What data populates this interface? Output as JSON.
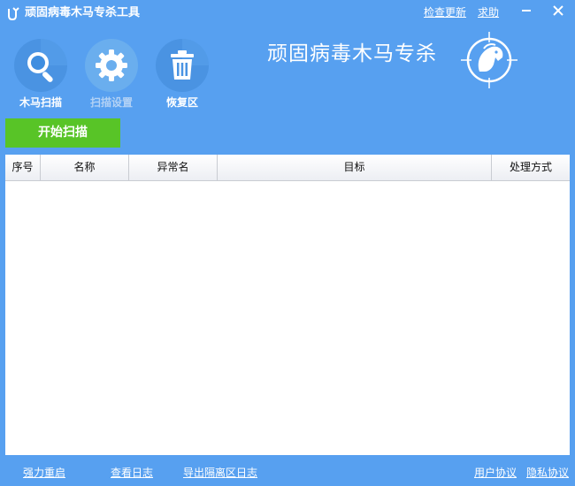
{
  "window": {
    "title": "顽固病毒木马专杀工具",
    "links": {
      "check_update": "检查更新",
      "help": "求助"
    },
    "controls": {
      "minimize": "minimize-icon",
      "close": "close-icon"
    }
  },
  "toolbar": {
    "items": [
      {
        "label": "木马扫描",
        "icon": "magnifier-icon",
        "state": "active"
      },
      {
        "label": "扫描设置",
        "icon": "gear-icon",
        "state": "dimmed"
      },
      {
        "label": "恢复区",
        "icon": "trash-icon",
        "state": "active"
      }
    ]
  },
  "brand": {
    "text": "顽固病毒木马专杀",
    "logo_icon": "trojan-horse-crosshair-icon"
  },
  "actions": {
    "start_scan": "开始扫描"
  },
  "table": {
    "columns": [
      "序号",
      "名称",
      "异常名",
      "目标",
      "处理方式"
    ],
    "rows": []
  },
  "footer": {
    "left_links": [
      "强力重启",
      "查看日志",
      "导出隔离区日志"
    ],
    "right_links": [
      "用户协议",
      "隐私协议"
    ]
  },
  "colors": {
    "background": "#57a0f0",
    "start_button": "#58c427",
    "icon_circle": "#4a93e2",
    "table_header": "#eceef3"
  }
}
